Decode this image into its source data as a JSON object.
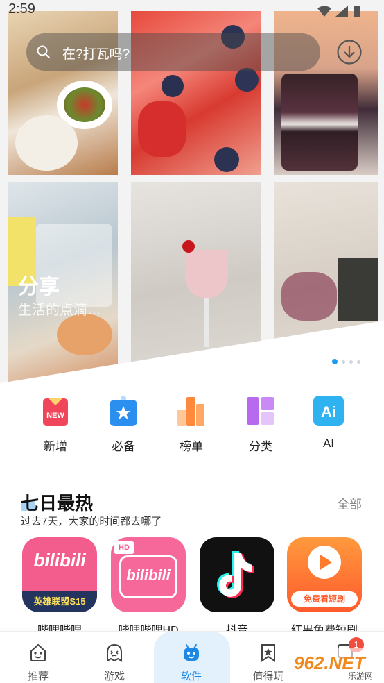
{
  "status_bar": {
    "time": "2:59"
  },
  "search": {
    "placeholder": "在?打瓦吗?"
  },
  "banner": {
    "title": "分享",
    "subtitle": "生活的点滴…",
    "page_count": 4,
    "current_page": 1
  },
  "categories": [
    {
      "label": "新增",
      "icon": "new-badge-icon",
      "badge": "NEW"
    },
    {
      "label": "必备",
      "icon": "star-bag-icon"
    },
    {
      "label": "榜单",
      "icon": "bar-ranking-icon"
    },
    {
      "label": "分类",
      "icon": "grid-category-icon"
    },
    {
      "label": "AI",
      "icon": "ai-icon",
      "badge": "Ai"
    }
  ],
  "section": {
    "title": "七日最热",
    "subtitle": "过去7天，大家的时间都去哪了",
    "more_label": "全部"
  },
  "apps": [
    {
      "name": "哔哩哔哩",
      "icon_text": "bilibili",
      "tag": "英雄联盟S15"
    },
    {
      "name": "哔哩哔哩HD",
      "icon_text": "bilibili",
      "tag": "HD"
    },
    {
      "name": "抖音",
      "icon": "tiktok-note-icon"
    },
    {
      "name": "红果免费短剧",
      "icon_text": "免费看短剧",
      "icon": "play-icon"
    }
  ],
  "bottom_nav": [
    {
      "label": "推荐",
      "icon": "smile-face-icon"
    },
    {
      "label": "游戏",
      "icon": "ghost-face-icon"
    },
    {
      "label": "软件",
      "icon": "android-icon",
      "active": true
    },
    {
      "label": "值得玩",
      "icon": "bookmark-star-icon"
    },
    {
      "label": "",
      "icon": "chat-icon",
      "badge": "1"
    }
  ],
  "watermark": {
    "text": "962.NET",
    "sub": "乐游网"
  },
  "colors": {
    "accent": "#1e88e5",
    "pill": "#e3f1fd",
    "badge": "#f24c3d"
  }
}
